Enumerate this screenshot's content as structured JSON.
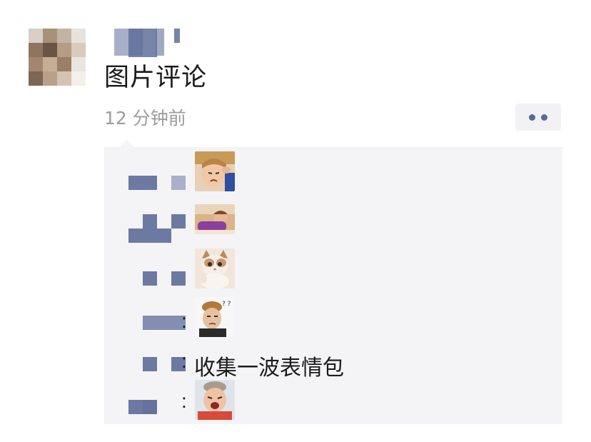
{
  "post": {
    "text": "图片评论",
    "time": "12 分钟前"
  },
  "comments": [
    {
      "type": "sticker",
      "sticker": "crying-woman-sticker"
    },
    {
      "type": "sticker",
      "sticker": "lying-woman-sticker"
    },
    {
      "type": "sticker",
      "sticker": "cat-sticker"
    },
    {
      "type": "sticker",
      "sticker": "confused-woman-sticker"
    },
    {
      "type": "text",
      "colon": ":",
      "text": "收集一波表情包"
    },
    {
      "type": "sticker",
      "colon": ":",
      "sticker": "screaming-woman-sticker"
    }
  ],
  "colors": {
    "accent": "#5b6a93",
    "comment_bg": "#f4f4f6",
    "time": "#9c9c9c"
  }
}
